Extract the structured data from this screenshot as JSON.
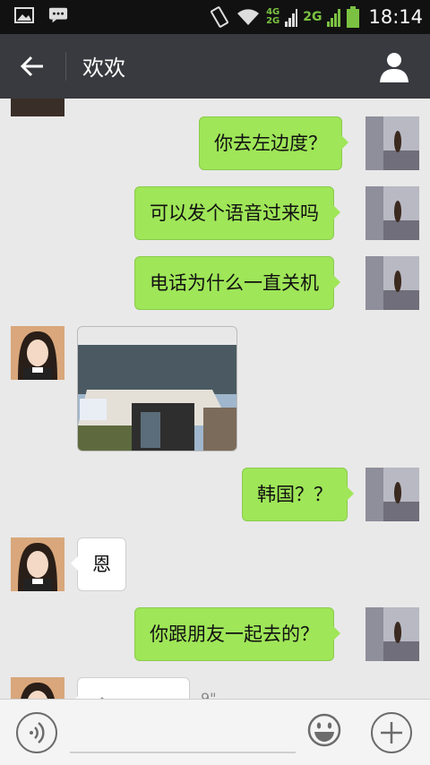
{
  "status_bar": {
    "time": "18:14",
    "network_top": "4G",
    "network_bottom": "2G",
    "network_2g": "2G"
  },
  "header": {
    "title": "欢欢"
  },
  "messages": [
    {
      "sender": "me",
      "text": "你去左边度？"
    },
    {
      "sender": "me",
      "text": "可以发个语音过来吗"
    },
    {
      "sender": "me",
      "text": "电话为什么一直关机"
    },
    {
      "sender": "other",
      "type": "image"
    },
    {
      "sender": "me",
      "text": "韩国？？"
    },
    {
      "sender": "other",
      "text": "恩"
    },
    {
      "sender": "me",
      "text": "你跟朋友一起去的？"
    }
  ],
  "voice_message": {
    "duration_partial": "9\""
  },
  "input_bar": {
    "placeholder": ""
  },
  "colors": {
    "title_bar": "#393a3f",
    "my_bubble": "#9fe658",
    "chat_bg": "#e9e9e9"
  }
}
